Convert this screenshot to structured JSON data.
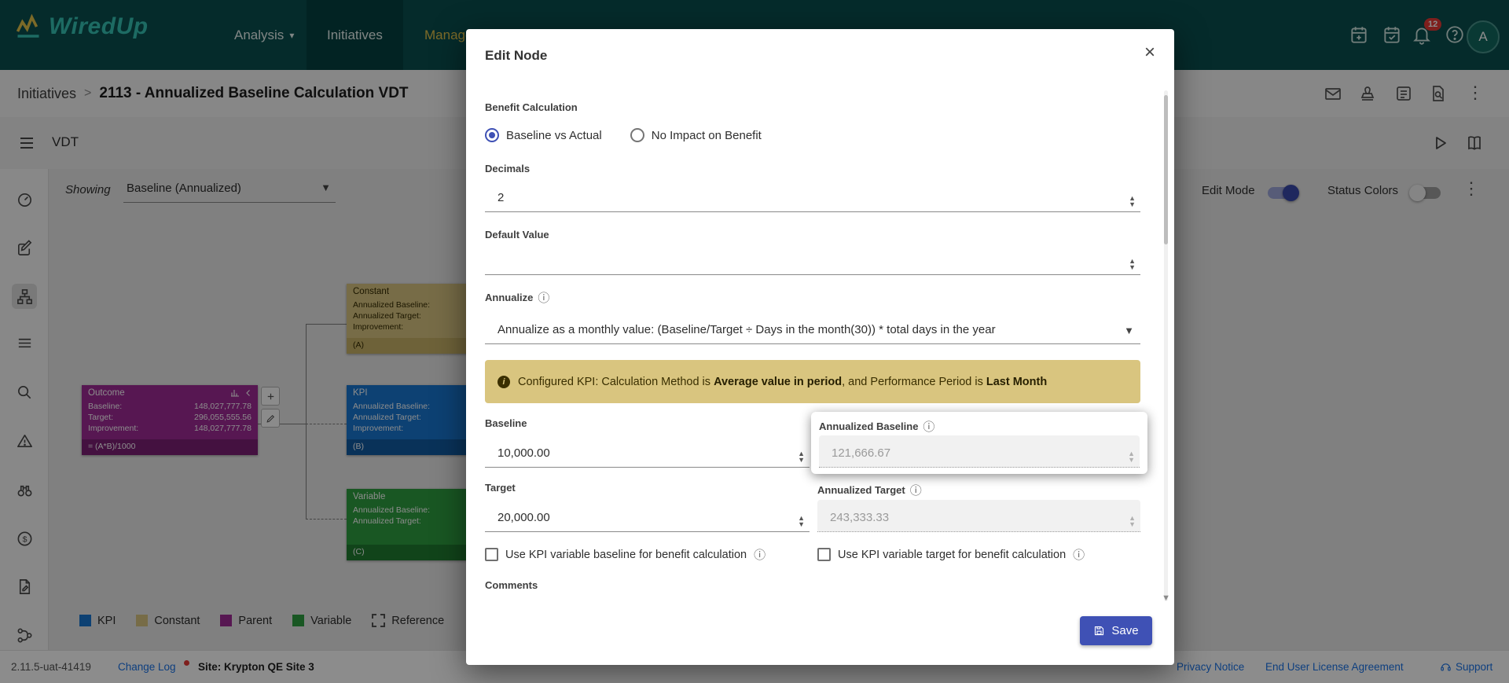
{
  "colors": {
    "nav_bg": "#0a4f4f",
    "accent": "#3f51b5",
    "kpi_blue": "#1977d2",
    "constant_tan": "#d9c581",
    "parent_magenta": "#9e2b96",
    "variable_green": "#2f9e41",
    "banner_bg": "#d9c57f",
    "link_blue": "#1a73e8",
    "badge_red": "#e53935"
  },
  "nav": {
    "brand": "WiredUp",
    "tabs": [
      {
        "label": "Analysis"
      },
      {
        "label": "Initiatives"
      },
      {
        "label": "Manage"
      }
    ],
    "notification_count": "12",
    "avatar_initial": "A"
  },
  "breadcrumb": {
    "root": "Initiatives",
    "separator": ">",
    "current": "2113 - Annualized Baseline Calculation VDT"
  },
  "toolbar": {
    "title": "VDT"
  },
  "canvas": {
    "showing_label": "Showing",
    "showing_value": "Baseline (Annualized)",
    "edit_mode_label": "Edit Mode",
    "status_colors_label": "Status Colors",
    "nodes": {
      "outcome": {
        "title": "Outcome",
        "rows": [
          {
            "label": "Baseline:",
            "value": "148,027,777.78"
          },
          {
            "label": "Target:",
            "value": "296,055,555.56"
          },
          {
            "label": "Improvement:",
            "value": "148,027,777.78"
          }
        ],
        "formula": "= (A*B)/1000"
      },
      "constant": {
        "title": "Constant",
        "rows": [
          {
            "label": "Annualized Baseline:"
          },
          {
            "label": "Annualized Target:"
          },
          {
            "label": "Improvement:"
          }
        ],
        "tag": "(A)"
      },
      "kpi": {
        "title": "KPI",
        "rows": [
          {
            "label": "Annualized Baseline:"
          },
          {
            "label": "Annualized Target:"
          },
          {
            "label": "Improvement:"
          }
        ],
        "tag": "(B)"
      },
      "variable": {
        "title": "Variable",
        "rows": [
          {
            "label": "Annualized Baseline:"
          },
          {
            "label": "Annualized Target:"
          }
        ],
        "tag": "(C)"
      }
    },
    "legend": [
      {
        "label": "KPI"
      },
      {
        "label": "Constant"
      },
      {
        "label": "Parent"
      },
      {
        "label": "Variable"
      },
      {
        "label": "Reference"
      }
    ]
  },
  "modal": {
    "title": "Edit Node",
    "benefit_calculation": {
      "label": "Benefit Calculation",
      "options": [
        {
          "label": "Baseline vs Actual",
          "selected": true
        },
        {
          "label": "No Impact on Benefit",
          "selected": false
        }
      ]
    },
    "decimals": {
      "label": "Decimals",
      "value": "2"
    },
    "default_value": {
      "label": "Default Value",
      "value": ""
    },
    "annualize": {
      "label": "Annualize",
      "value": "Annualize as a monthly value: (Baseline/Target ÷ Days in the month(30)) * total days in the year"
    },
    "banner": {
      "text_1": "Configured KPI: Calculation Method is ",
      "bold_1": "Average value in period",
      "text_2": ", and Performance Period is ",
      "bold_2": "Last Month"
    },
    "baseline": {
      "label": "Baseline",
      "value": "10,000.00"
    },
    "annualized_baseline": {
      "label": "Annualized Baseline",
      "value": "121,666.67"
    },
    "target": {
      "label": "Target",
      "value": "20,000.00"
    },
    "annualized_target": {
      "label": "Annualized Target",
      "value": "243,333.33"
    },
    "checkboxes": [
      {
        "label": "Use KPI variable baseline for benefit calculation",
        "checked": false
      },
      {
        "label": "Use KPI variable target for benefit calculation",
        "checked": false
      }
    ],
    "comments_label": "Comments",
    "save_label": "Save"
  },
  "footer": {
    "version": "2.11.5-uat-41419",
    "change_log": "Change Log",
    "site": "Site: Krypton QE Site 3",
    "privacy": "Privacy Notice",
    "eula": "End User License Agreement",
    "support": "Support"
  }
}
